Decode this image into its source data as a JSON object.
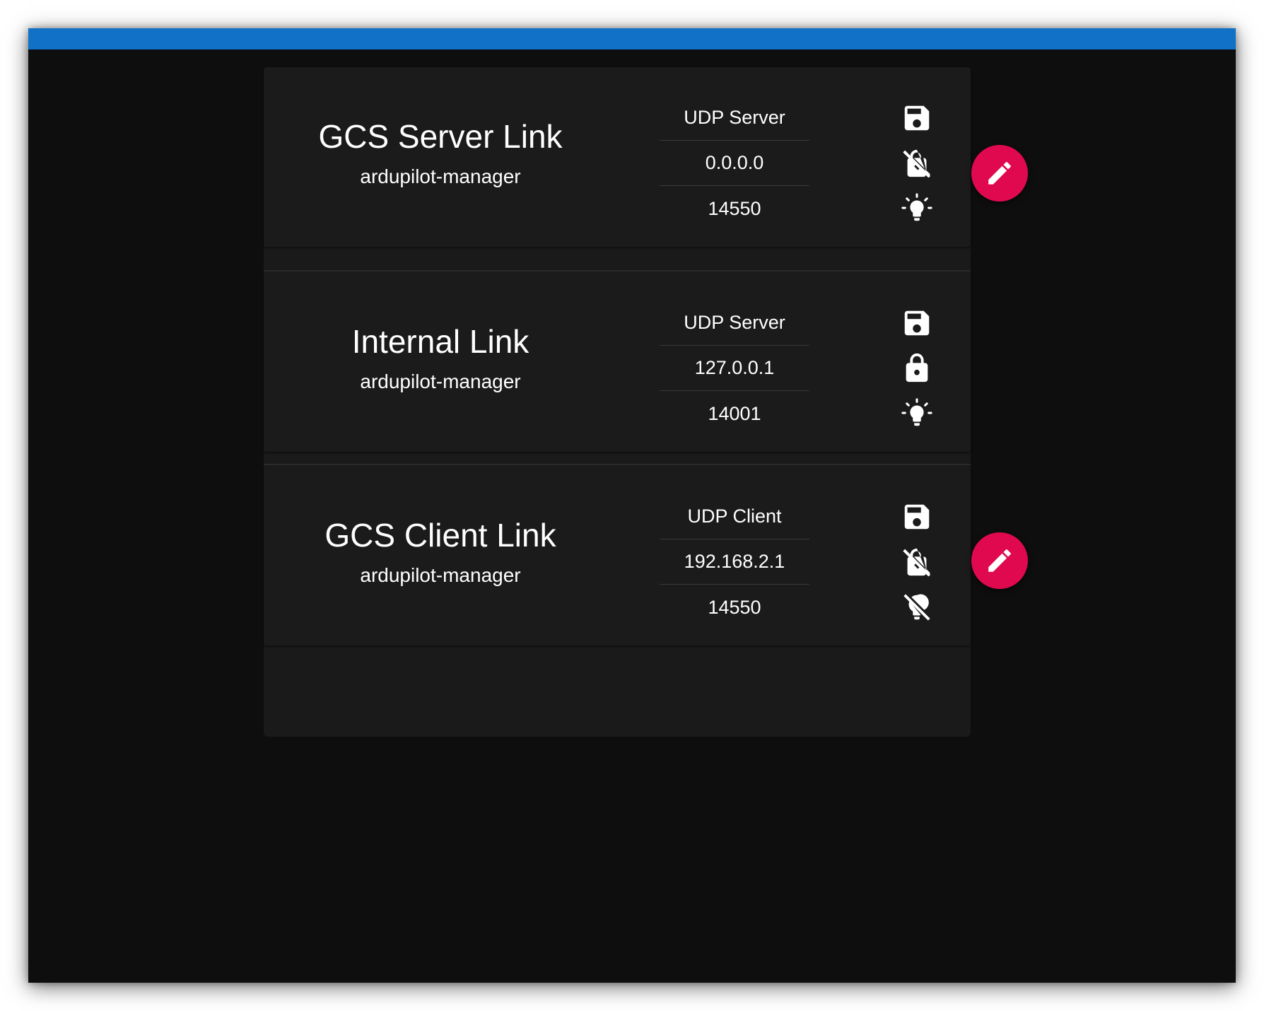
{
  "colors": {
    "topbar": "#1171c6",
    "window_bg": "#0e0e0e",
    "panel_bg": "#1a1a1a",
    "fab_accent": "#e0094f",
    "text": "#ffffff"
  },
  "endpoints": [
    {
      "name": "GCS Server Link",
      "owner": "ardupilot-manager",
      "type": "UDP Server",
      "address": "0.0.0.0",
      "port": "14550",
      "icons": [
        "floppy-disk-icon",
        "lock-off-icon",
        "lightbulb-on-icon"
      ],
      "editable": true
    },
    {
      "name": "Internal Link",
      "owner": "ardupilot-manager",
      "type": "UDP Server",
      "address": "127.0.0.1",
      "port": "14001",
      "icons": [
        "floppy-disk-icon",
        "lock-icon",
        "lightbulb-on-icon"
      ],
      "editable": false
    },
    {
      "name": "GCS Client Link",
      "owner": "ardupilot-manager",
      "type": "UDP Client",
      "address": "192.168.2.1",
      "port": "14550",
      "icons": [
        "floppy-disk-icon",
        "lock-off-icon",
        "lightbulb-off-icon"
      ],
      "editable": true
    }
  ],
  "actions": {
    "edit_icon": "pencil-icon"
  }
}
